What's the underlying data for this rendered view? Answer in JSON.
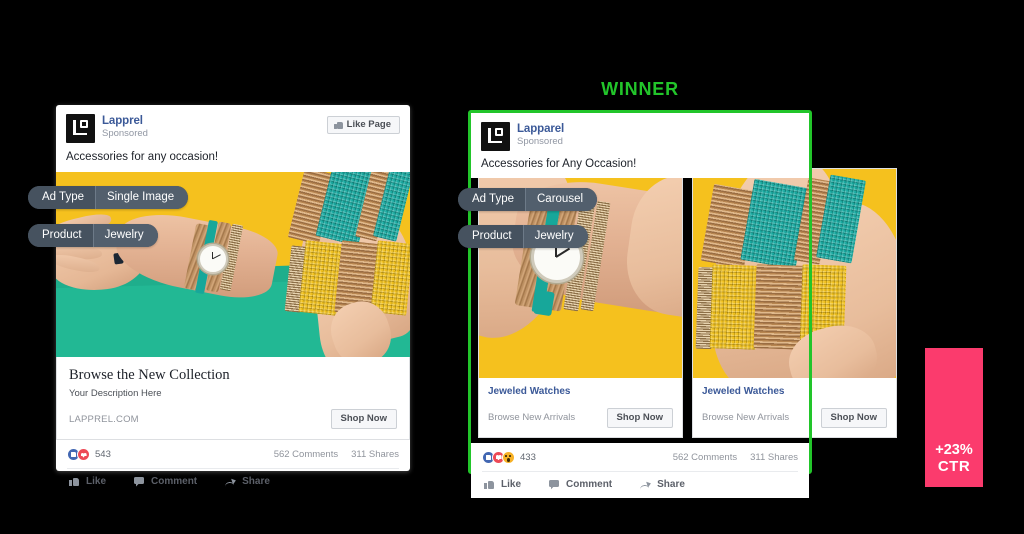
{
  "winner_label": "WINNER",
  "colors": {
    "winner_green": "#22c52a",
    "ctr_pink": "#fb3b6d",
    "fb_blue": "#3b5998",
    "pill_dark": "#46525f",
    "photo_yellow": "#f5c11e",
    "photo_teal": "#22b894"
  },
  "left_ad": {
    "page_name": "Lapprel",
    "sponsored": "Sponsored",
    "like_page_button": "Like Page",
    "post_text": "Accessories for any occasion!",
    "link_title": "Browse the New Collection",
    "link_description": "Your Description Here",
    "link_domain": "LAPPREL.COM",
    "cta_button": "Shop Now",
    "reaction_count": "543",
    "comments": "562 Comments",
    "shares": "311 Shares",
    "actions": [
      "Like",
      "Comment",
      "Share"
    ],
    "reactions": [
      "like-reaction",
      "love-reaction"
    ],
    "pills": [
      {
        "key": "Ad Type",
        "value": "Single Image"
      },
      {
        "key": "Product",
        "value": "Jewelry"
      }
    ]
  },
  "right_ad": {
    "page_name": "Lapparel",
    "sponsored": "Sponsored",
    "post_text": "Accessories for Any Occasion!",
    "reaction_count": "433",
    "comments": "562 Comments",
    "shares": "311 Shares",
    "actions": [
      "Like",
      "Comment",
      "Share"
    ],
    "reactions": [
      "like-reaction",
      "love-reaction",
      "wow-reaction"
    ],
    "pills": [
      {
        "key": "Ad Type",
        "value": "Carousel"
      },
      {
        "key": "Product",
        "value": "Jewelry"
      }
    ],
    "carousel": [
      {
        "title": "Jeweled Watches",
        "subtitle": "Browse New Arrivals",
        "cta_button": "Shop Now"
      },
      {
        "title": "Jeweled Watches",
        "subtitle": "Browse New Arrivals",
        "cta_button": "Shop Now"
      }
    ]
  },
  "ctr_badge": {
    "percent": "+23%",
    "label": "CTR"
  }
}
